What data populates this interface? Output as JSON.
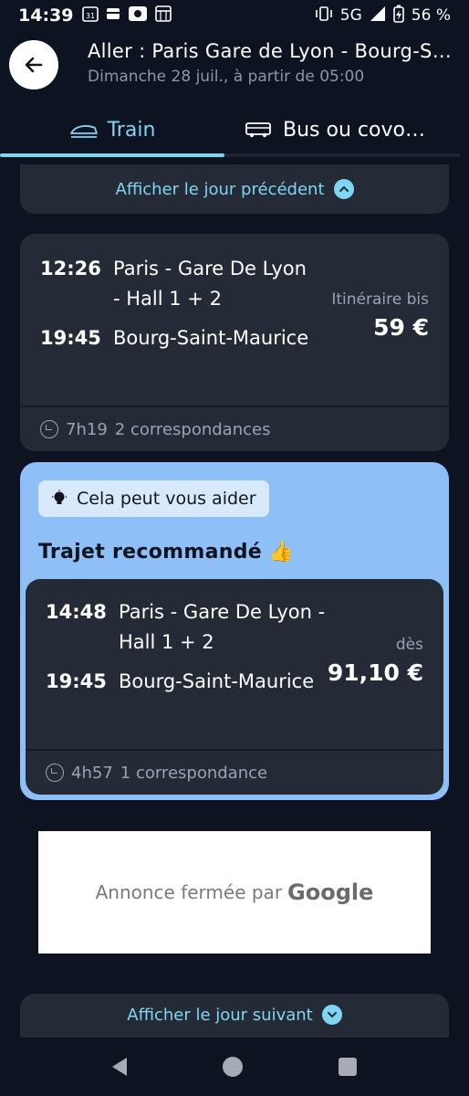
{
  "status": {
    "time": "14:39",
    "calendar_day": "31",
    "network": "5G",
    "battery": "56 %"
  },
  "header": {
    "title": "Aller : Paris Gare de Lyon - Bourg-Saint-Maurice",
    "subtitle": "Dimanche 28 juil., à partir de 05:00"
  },
  "tabs": [
    {
      "label": "Train",
      "active": true,
      "icon": "train-icon"
    },
    {
      "label": "Bus ou covoiturage",
      "active": false,
      "icon": "bus-icon"
    }
  ],
  "prev_day": {
    "label": "Afficher le jour précédent",
    "icon": "chevron-up-icon"
  },
  "trip1": {
    "dep_time": "12:26",
    "dep_station": "Paris - Gare De Lyon - Hall 1 + 2",
    "arr_time": "19:45",
    "arr_station": "Bourg-Saint-Maurice",
    "price_label": "Itinéraire bis",
    "price": "59 €",
    "duration": "7h19",
    "connections": "2 correspondances"
  },
  "recommendation": {
    "badge": "Cela peut vous aider",
    "title": "Trajet recommandé 👍",
    "trip": {
      "dep_time": "14:48",
      "dep_station": "Paris - Gare De Lyon - Hall 1 + 2",
      "arr_time": "19:45",
      "arr_station": "Bourg-Saint-Maurice",
      "price_label": "dès",
      "price": "91,10 €",
      "duration": "4h57",
      "connections": "1 correspondance"
    }
  },
  "ad": {
    "text": "Annonce fermée par",
    "brand": "Google"
  },
  "next_day": {
    "label": "Afficher le jour suivant",
    "icon": "chevron-down-icon"
  },
  "colors": {
    "accent": "#7fd6f2",
    "background": "#0d1320",
    "card": "#242a36",
    "recommended": "#8ec0f7"
  }
}
